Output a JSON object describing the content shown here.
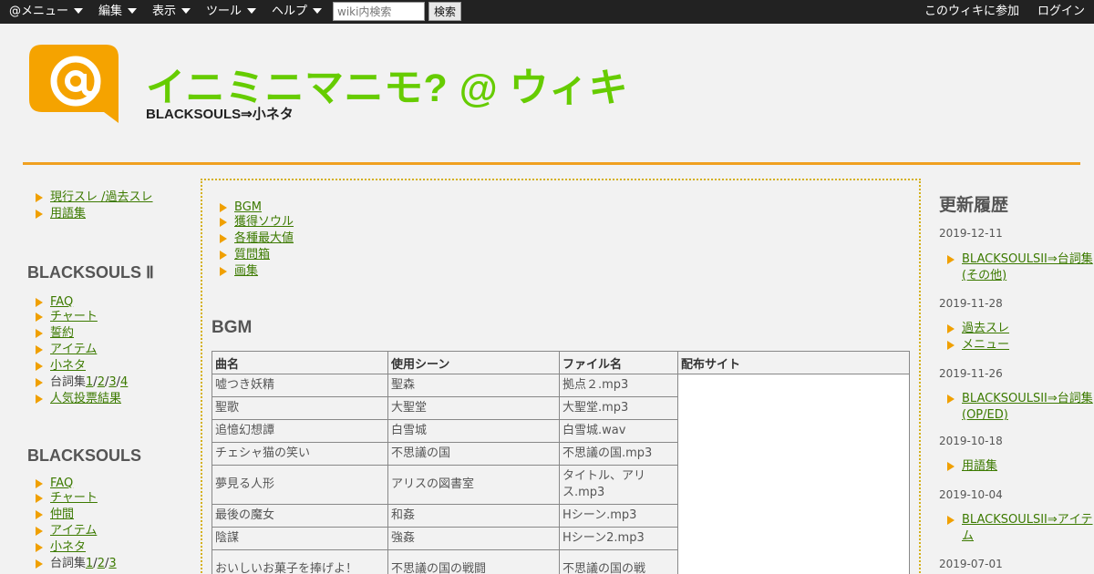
{
  "topbar": {
    "menus": [
      "@メニュー",
      "編集",
      "表示",
      "ツール",
      "ヘルプ"
    ],
    "search_placeholder": "wiki内検索",
    "search_button": "検索",
    "join": "このウィキに参加",
    "login": "ログイン"
  },
  "header": {
    "title": "イニミニマニモ? @ ウィキ",
    "subtitle": "BLACKSOULS⇒小ネタ",
    "logo_icon": "at-sign-logo-icon"
  },
  "colors": {
    "accent": "#f0a020",
    "title": "#66cc00",
    "link": "#3c7a00",
    "bullet": "#f0a000"
  },
  "left_nav": {
    "top_links": [
      {
        "a": "現行スレ",
        "sep": " /",
        "b": "過去スレ"
      },
      {
        "a": "用語集"
      }
    ],
    "bs2": {
      "heading": "BLACKSOULS Ⅱ",
      "items": [
        "FAQ",
        "チャート",
        "誓約",
        "アイテム",
        "小ネタ"
      ],
      "dialogue_label": "台詞集",
      "dialogue_parts": [
        "1",
        "2",
        "3",
        "4"
      ],
      "last": "人気投票結果"
    },
    "bs1": {
      "heading": "BLACKSOULS",
      "items": [
        "FAQ",
        "チャート",
        "仲間",
        "アイテム",
        "小ネタ"
      ],
      "dialogue_label": "台詞集",
      "dialogue_parts": [
        "1",
        "2",
        "3"
      ]
    }
  },
  "main": {
    "toc": [
      "BGM",
      "獲得ソウル",
      "各種最大値",
      "質問箱",
      "画集"
    ],
    "bgm_heading": "BGM",
    "table": {
      "headers": [
        "曲名",
        "使用シーン",
        "ファイル名",
        "配布サイト"
      ],
      "rows": [
        [
          "嘘つき妖精",
          "聖森",
          "拠点２.mp3"
        ],
        [
          "聖歌",
          "大聖堂",
          "大聖堂.mp3"
        ],
        [
          "追憶幻想譚",
          "白雪城",
          "白雪城.wav"
        ],
        [
          "チェシャ猫の笑い",
          "不思議の国",
          "不思議の国.mp3"
        ],
        [
          "夢見る人形",
          "アリスの図書室",
          "タイトル、アリス.mp3"
        ],
        [
          "最後の魔女",
          "和姦",
          "Hシーン.mp3"
        ],
        [
          "陰謀",
          "強姦",
          "Hシーン2.mp3"
        ],
        [
          "おいしいお菓子を捧げよ！",
          "不思議の国の戦闘",
          "不思議の国の戦"
        ]
      ]
    }
  },
  "history": {
    "heading": "更新履歴",
    "groups": [
      {
        "date": "2019-12-11",
        "items": [
          "BLACKSOULSII⇒台詞集(その他)"
        ]
      },
      {
        "date": "2019-11-28",
        "items": [
          "過去スレ",
          "メニュー"
        ]
      },
      {
        "date": "2019-11-26",
        "items": [
          "BLACKSOULSII⇒台詞集(OP/ED)"
        ]
      },
      {
        "date": "2019-10-18",
        "items": [
          "用語集"
        ]
      },
      {
        "date": "2019-10-04",
        "items": [
          "BLACKSOULSII⇒アイテム"
        ]
      },
      {
        "date": "2019-07-01",
        "items": []
      }
    ]
  }
}
